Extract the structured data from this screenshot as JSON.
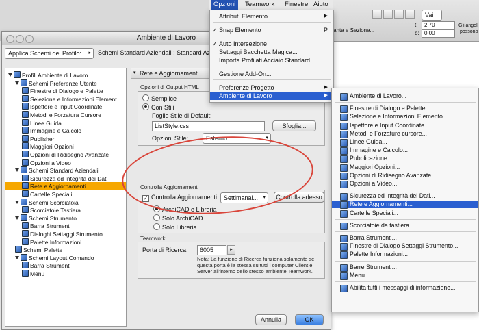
{
  "menubar": {
    "items": [
      {
        "label": "Opzioni",
        "active": true
      },
      {
        "label": "Teamwork"
      },
      {
        "label": "Finestre"
      },
      {
        "label": "Aiuto"
      }
    ]
  },
  "menu": {
    "items": [
      {
        "label": "Attributi Elemento",
        "submenu": true
      },
      {
        "label": "Snap Elemento",
        "check": "✓",
        "shortcut": "P"
      },
      {
        "label": "Auto Intersezione",
        "check": "✓"
      },
      {
        "label": "Settaggi Bacchetta Magica..."
      },
      {
        "label": "Importa Profilati Acciaio Standard..."
      },
      {
        "label": "Gestione Add-On..."
      },
      {
        "label": "Preferenze Progetto",
        "submenu": true
      },
      {
        "label": "Ambiente di Lavoro",
        "submenu": true,
        "highlighted": true
      }
    ]
  },
  "toolbar": {
    "vai": "Vai",
    "pianta": "Pianta e Sezione...",
    "t_label": "t:",
    "t_value": "2,70",
    "b_label": "b:",
    "b_value": "0,00",
    "gli_label": "Gli angoli",
    "possono": "possono"
  },
  "dialog": {
    "title": "Ambiente di Lavoro",
    "apply_label": "Applica Schemi del Profilo:",
    "apply_value": "Schemi Standard Aziendali : Standard Azi",
    "tree": [
      {
        "label": "Profili Ambiente di Lavoro",
        "level": 0,
        "tri": true
      },
      {
        "label": "Schemi Preferenze Utente",
        "level": 1,
        "tri": true
      },
      {
        "label": "Finestre di Dialogo e Palette",
        "level": 2
      },
      {
        "label": "Selezione e Informazioni Element",
        "level": 2
      },
      {
        "label": "Ispettore e Input Coordinate",
        "level": 2
      },
      {
        "label": "Metodi e Forzatura Cursore",
        "level": 2
      },
      {
        "label": "Linee Guida",
        "level": 2
      },
      {
        "label": "Immagine e Calcolo",
        "level": 2
      },
      {
        "label": "Publisher",
        "level": 2
      },
      {
        "label": "Maggiori Opzioni",
        "level": 2
      },
      {
        "label": "Opzioni di Ridisegno Avanzate",
        "level": 2
      },
      {
        "label": "Opzioni a Video",
        "level": 2
      },
      {
        "label": "Schemi Standard Aziendali",
        "level": 1,
        "tri": true
      },
      {
        "label": "Sicurezza ed Integrità dei Dati",
        "level": 2
      },
      {
        "label": "Rete e Aggiornamenti",
        "level": 2,
        "selected": true
      },
      {
        "label": "Cartelle Speciali",
        "level": 2
      },
      {
        "label": "Schemi Scorciatoia",
        "level": 1,
        "tri": true
      },
      {
        "label": "Scorciatoie Tastiera",
        "level": 2
      },
      {
        "label": "Schemi Strumento",
        "level": 1,
        "tri": true
      },
      {
        "label": "Barra Strumenti",
        "level": 2
      },
      {
        "label": "Dialoghi Settaggi Strumento",
        "level": 2
      },
      {
        "label": "Palette Informazioni",
        "level": 2
      },
      {
        "label": "Schemi Palette",
        "level": 1
      },
      {
        "label": "Schemi Layout Comando",
        "level": 1,
        "tri": true
      },
      {
        "label": "Barra Strumenti",
        "level": 2
      },
      {
        "label": "Menu",
        "level": 2
      }
    ],
    "section_title": "Rete e Aggiornamenti",
    "html_group": "Opzioni di Output HTML",
    "semplice": "Semplice",
    "con_stili": "Con Stili",
    "foglio_label": "Foglio Stile di Default:",
    "foglio_value": "ListStyle.css",
    "sfoglia": "Sfoglia...",
    "opzioni_stile_label": "Opzioni Stile:",
    "opzioni_stile_value": "Esterno",
    "update_group": "Controlla Aggiornamenti",
    "update_check_label": "Controlla Aggiornamenti:",
    "update_freq": "Settimanal...",
    "controlla_adesso": "Controlla adesso",
    "radio_archicad_lib": "ArchiCAD e Libreria",
    "radio_solo_archicad": "Solo ArchiCAD",
    "radio_solo_libreria": "Solo Libreria",
    "teamwork_group": "Teamwork",
    "porta_label": "Porta di Ricerca:",
    "porta_value": "6005",
    "note": "Nota: La funzione di Ricerca funziona solamente se questa porta è la stessa su tutti i computer Client e Server all'interno dello stesso ambiente Teamwork.",
    "annulla": "Annulla",
    "ok": "OK"
  },
  "submenu": {
    "items": [
      {
        "label": "Ambiente di Lavoro..."
      },
      {
        "sep": true
      },
      {
        "label": "Finestre di Dialogo e Palette..."
      },
      {
        "label": "Selezione e Informazioni Elemento..."
      },
      {
        "label": "Ispettore e Input Coordinate..."
      },
      {
        "label": "Metodi e Forzature cursore..."
      },
      {
        "label": "Linee Guida..."
      },
      {
        "label": "Immagine e Calcolo..."
      },
      {
        "label": "Pubblicazione..."
      },
      {
        "label": "Maggiori Opzioni..."
      },
      {
        "label": "Opzioni di Ridisegno Avanzate..."
      },
      {
        "label": "Opzioni a Video..."
      },
      {
        "sep": true
      },
      {
        "label": "Sicurezza ed Integrità dei Dati..."
      },
      {
        "label": "Rete e Aggiornamenti...",
        "highlighted": true
      },
      {
        "label": "Cartelle Speciali..."
      },
      {
        "sep": true
      },
      {
        "label": "Scorciatoie da tastiera..."
      },
      {
        "sep": true
      },
      {
        "label": "Barra Strumenti..."
      },
      {
        "label": "Finestre di Dialogo Settaggi Strumento..."
      },
      {
        "label": "Palette Informazioni..."
      },
      {
        "sep": true
      },
      {
        "label": "Barre Strumenti..."
      },
      {
        "label": "Menu..."
      },
      {
        "sep": true
      },
      {
        "label": "Abilita tutti i messaggi di informazione..."
      }
    ]
  },
  "colors": {
    "highlight": "#2a5fd0",
    "tree_selected": "#f6a700",
    "annotation": "#d9453a"
  }
}
